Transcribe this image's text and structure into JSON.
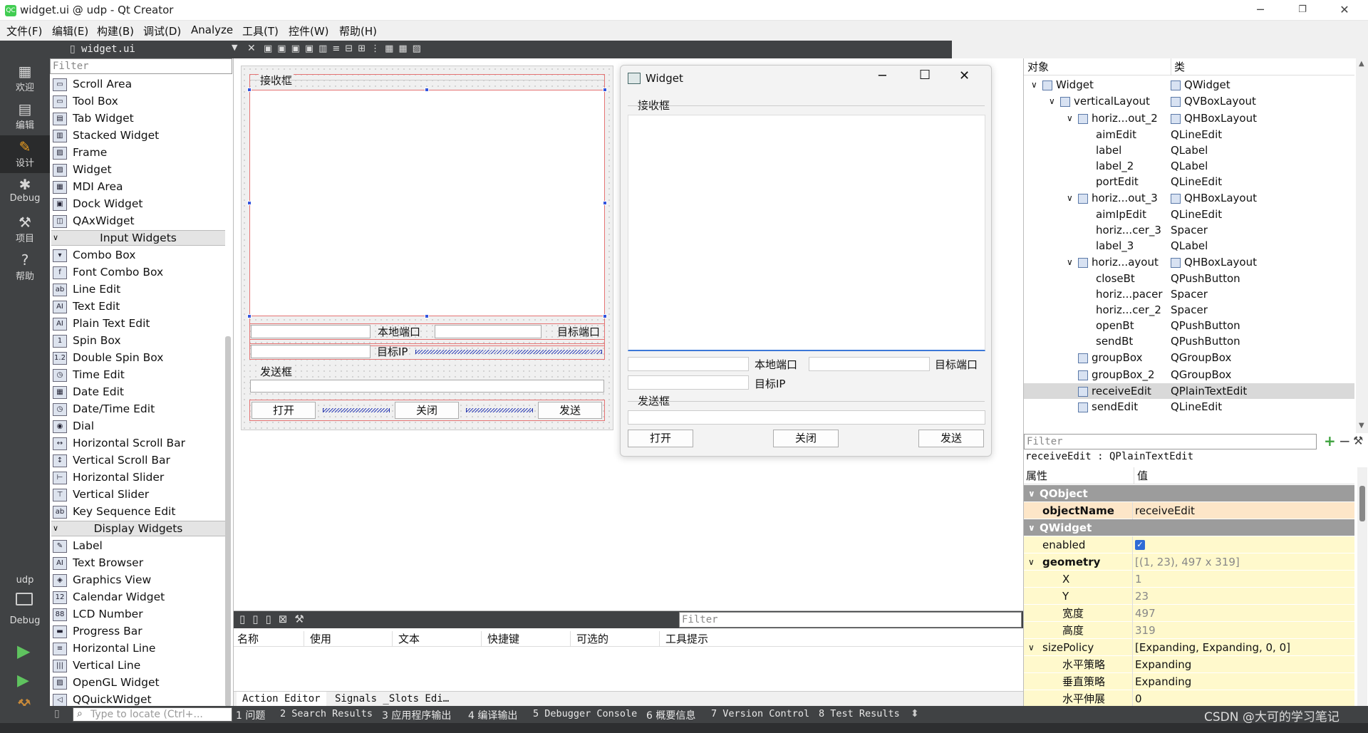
{
  "window": {
    "title": "widget.ui @ udp - Qt Creator",
    "app_icon": "QC"
  },
  "menu": [
    "文件(F)",
    "编辑(E)",
    "构建(B)",
    "调试(D)",
    "Analyze",
    "工具(T)",
    "控件(W)",
    "帮助(H)"
  ],
  "modes": [
    {
      "label": "欢迎",
      "icon": "grid-icon"
    },
    {
      "label": "编辑",
      "icon": "document-icon"
    },
    {
      "label": "设计",
      "icon": "pencil-icon"
    },
    {
      "label": "Debug",
      "icon": "bug-icon"
    },
    {
      "label": "项目",
      "icon": "wrench-icon"
    },
    {
      "label": "帮助",
      "icon": "help-icon"
    }
  ],
  "kit": {
    "project": "udp",
    "config": "Debug"
  },
  "doc_tab": "widget.ui",
  "widget_box": {
    "filter_placeholder": "Filter",
    "items": [
      "Scroll Area",
      "Tool Box",
      "Tab Widget",
      "Stacked Widget",
      "Frame",
      "Widget",
      "MDI Area",
      "Dock Widget",
      "QAxWidget"
    ],
    "input_category": "Input Widgets",
    "input_items": [
      "Combo Box",
      "Font Combo Box",
      "Line Edit",
      "Text Edit",
      "Plain Text Edit",
      "Spin Box",
      "Double Spin Box",
      "Time Edit",
      "Date Edit",
      "Date/Time Edit",
      "Dial",
      "Horizontal Scroll Bar",
      "Vertical Scroll Bar",
      "Horizontal Slider",
      "Vertical Slider",
      "Key Sequence Edit"
    ],
    "display_category": "Display Widgets",
    "display_items": [
      "Label",
      "Text Browser",
      "Graphics View",
      "Calendar Widget",
      "LCD Number",
      "Progress Bar",
      "Horizontal Line",
      "Vertical Line",
      "OpenGL Widget",
      "QQuickWidget"
    ]
  },
  "form": {
    "receive_group": "接收框",
    "local_port_label": "本地端口",
    "target_port_label": "目标端口",
    "target_ip_label": "目标IP",
    "send_group": "发送框",
    "open_button": "打开",
    "close_button": "关闭",
    "send_button": "发送"
  },
  "preview": {
    "title": "Widget",
    "receive_group": "接收框",
    "local_port_label": "本地端口",
    "target_port_label": "目标端口",
    "target_ip_label": "目标IP",
    "send_group": "发送框",
    "open_button": "打开",
    "close_button": "关闭",
    "send_button": "发送"
  },
  "action_editor": {
    "filter_placeholder": "Filter",
    "columns": [
      "名称",
      "使用",
      "文本",
      "快捷键",
      "可选的",
      "工具提示"
    ],
    "tabs": [
      "Action Editor",
      "Signals _Slots Edi…"
    ]
  },
  "object_inspector": {
    "headers": [
      "对象",
      "类"
    ],
    "rows": [
      {
        "name": "Widget",
        "class": "QWidget",
        "indent": 0,
        "expand": "∨"
      },
      {
        "name": "verticalLayout",
        "class": "QVBoxLayout",
        "indent": 1,
        "expand": "∨"
      },
      {
        "name": "horiz...out_2",
        "class": "QHBoxLayout",
        "indent": 2,
        "expand": "∨"
      },
      {
        "name": "aimEdit",
        "class": "QLineEdit",
        "indent": 3,
        "expand": ""
      },
      {
        "name": "label",
        "class": "QLabel",
        "indent": 3,
        "expand": ""
      },
      {
        "name": "label_2",
        "class": "QLabel",
        "indent": 3,
        "expand": ""
      },
      {
        "name": "portEdit",
        "class": "QLineEdit",
        "indent": 3,
        "expand": ""
      },
      {
        "name": "horiz...out_3",
        "class": "QHBoxLayout",
        "indent": 2,
        "expand": "∨"
      },
      {
        "name": "aimIpEdit",
        "class": "QLineEdit",
        "indent": 3,
        "expand": ""
      },
      {
        "name": "horiz...cer_3",
        "class": "Spacer",
        "indent": 3,
        "expand": ""
      },
      {
        "name": "label_3",
        "class": "QLabel",
        "indent": 3,
        "expand": ""
      },
      {
        "name": "horiz...ayout",
        "class": "QHBoxLayout",
        "indent": 2,
        "expand": "∨"
      },
      {
        "name": "closeBt",
        "class": "QPushButton",
        "indent": 3,
        "expand": ""
      },
      {
        "name": "horiz...pacer",
        "class": "Spacer",
        "indent": 3,
        "expand": ""
      },
      {
        "name": "horiz...cer_2",
        "class": "Spacer",
        "indent": 3,
        "expand": ""
      },
      {
        "name": "openBt",
        "class": "QPushButton",
        "indent": 3,
        "expand": ""
      },
      {
        "name": "sendBt",
        "class": "QPushButton",
        "indent": 3,
        "expand": ""
      },
      {
        "name": "groupBox",
        "class": "QGroupBox",
        "indent": 2,
        "expand": ""
      },
      {
        "name": "groupBox_2",
        "class": "QGroupBox",
        "indent": 2,
        "expand": ""
      },
      {
        "name": "receiveEdit",
        "class": "QPlainTextEdit",
        "indent": 2,
        "expand": "",
        "selected": true
      },
      {
        "name": "sendEdit",
        "class": "QLineEdit",
        "indent": 2,
        "expand": ""
      }
    ]
  },
  "property_editor": {
    "filter_placeholder": "Filter",
    "object_caption": "receiveEdit : QPlainTextEdit",
    "headers": [
      "属性",
      "值"
    ],
    "rows": [
      {
        "type": "group",
        "name": "QObject"
      },
      {
        "type": "prop",
        "name": "objectName",
        "value": "receiveEdit",
        "bold": true,
        "style": "orange"
      },
      {
        "type": "group",
        "name": "QWidget"
      },
      {
        "type": "prop",
        "name": "enabled",
        "value": "✓",
        "check": true
      },
      {
        "type": "prop",
        "name": "geometry",
        "value": "[(1, 23), 497 x 319]",
        "bold": true,
        "expand": true,
        "gray": true
      },
      {
        "type": "sub",
        "name": "X",
        "value": "1"
      },
      {
        "type": "sub",
        "name": "Y",
        "value": "23"
      },
      {
        "type": "sub",
        "name": "宽度",
        "value": "497"
      },
      {
        "type": "sub",
        "name": "高度",
        "value": "319"
      },
      {
        "type": "prop",
        "name": "sizePolicy",
        "value": "[Expanding, Expanding, 0, 0]",
        "expand": true
      },
      {
        "type": "sub",
        "name": "水平策略",
        "value": "Expanding"
      },
      {
        "type": "sub",
        "name": "垂直策略",
        "value": "Expanding"
      },
      {
        "type": "sub",
        "name": "水平伸展",
        "value": "0"
      }
    ]
  },
  "status": {
    "locator_placeholder": "Type to locate (Ctrl+...",
    "panes": [
      "1 问题",
      "2 Search Results",
      "3 应用程序输出",
      "4 编译输出",
      "5 Debugger Console",
      "6 概要信息",
      "7 Version Control",
      "8 Test Results"
    ],
    "watermark": "CSDN @大可的学习笔记"
  }
}
